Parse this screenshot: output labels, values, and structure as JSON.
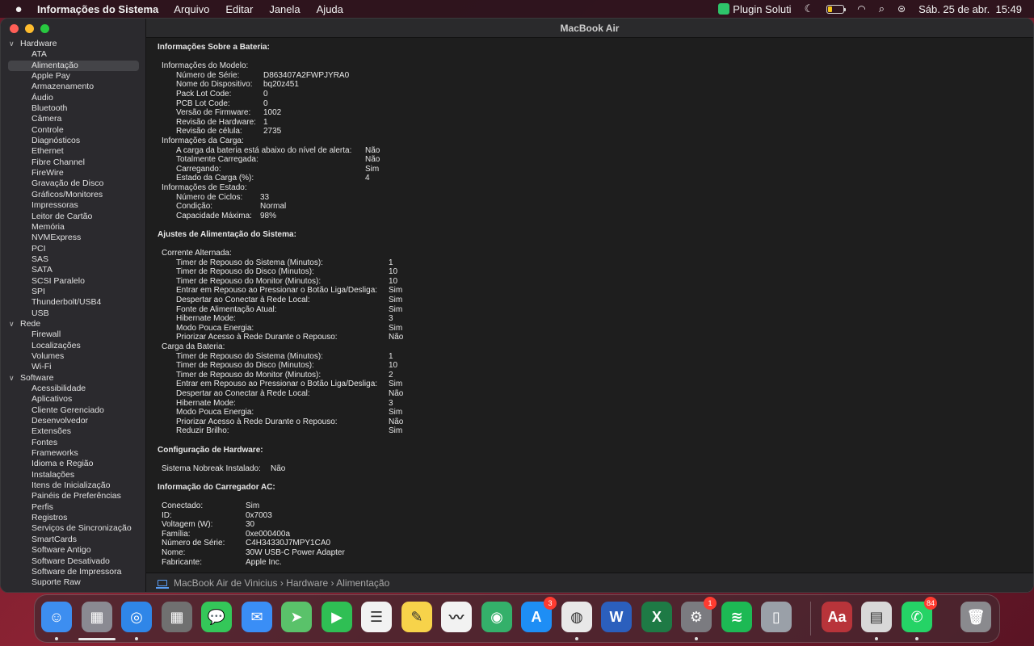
{
  "menubar": {
    "app_name": "Informações do Sistema",
    "menus": [
      "Arquivo",
      "Editar",
      "Janela",
      "Ajuda"
    ],
    "plugin_label": "Plugin Soluti",
    "datetime": "Sáb. 25 de abr.  15:49",
    "battery_level": 0.25
  },
  "window": {
    "title": "MacBook Air"
  },
  "sidebar": {
    "hardware": {
      "label": "Hardware",
      "items": [
        "ATA",
        "Alimentação",
        "Apple Pay",
        "Armazenamento",
        "Áudio",
        "Bluetooth",
        "Câmera",
        "Controle",
        "Diagnósticos",
        "Ethernet",
        "Fibre Channel",
        "FireWire",
        "Gravação de Disco",
        "Gráficos/Monitores",
        "Impressoras",
        "Leitor de Cartão",
        "Memória",
        "NVMExpress",
        "PCI",
        "SAS",
        "SATA",
        "SCSI Paralelo",
        "SPI",
        "Thunderbolt/USB4",
        "USB"
      ]
    },
    "rede": {
      "label": "Rede",
      "items": [
        "Firewall",
        "Localizações",
        "Volumes",
        "Wi-Fi"
      ]
    },
    "software": {
      "label": "Software",
      "items": [
        "Acessibilidade",
        "Aplicativos",
        "Cliente Gerenciado",
        "Desenvolvedor",
        "Extensões",
        "Fontes",
        "Frameworks",
        "Idioma e Região",
        "Instalações",
        "Itens de Inicialização",
        "Painéis de Preferências",
        "Perfis",
        "Registros",
        "Serviços de Sincronização",
        "SmartCards",
        "Software Antigo",
        "Software Desativado",
        "Software de Impressora",
        "Suporte Raw"
      ]
    },
    "selected": "Alimentação"
  },
  "content": {
    "battery_title": "Informações Sobre a Bateria:",
    "model_info": {
      "label": "Informações do Modelo:",
      "rows": [
        [
          "Número de Série:",
          "D863407A2FWPJYRA0"
        ],
        [
          "Nome do Dispositivo:",
          "bq20z451"
        ],
        [
          "Pack Lot Code:",
          "0"
        ],
        [
          "PCB Lot Code:",
          "0"
        ],
        [
          "Versão de Firmware:",
          "1002"
        ],
        [
          "Revisão de Hardware:",
          "1"
        ],
        [
          "Revisão de célula:",
          "2735"
        ]
      ]
    },
    "charge_info": {
      "label": "Informações da Carga:",
      "rows": [
        [
          "A carga da bateria está abaixo do nível de alerta:",
          "Não"
        ],
        [
          "Totalmente Carregada:",
          "Não"
        ],
        [
          "Carregando:",
          "Sim"
        ],
        [
          "Estado da Carga (%):",
          "4"
        ]
      ]
    },
    "health_info": {
      "label": "Informações de Estado:",
      "rows": [
        [
          "Número de Ciclos:",
          "33"
        ],
        [
          "Condição:",
          "Normal"
        ],
        [
          "Capacidade Máxima:",
          "98%"
        ]
      ]
    },
    "power_title": "Ajustes de Alimentação do Sistema:",
    "ac": {
      "label": "Corrente Alternada:",
      "rows": [
        [
          "Timer de Repouso do Sistema (Minutos):",
          "1"
        ],
        [
          "Timer de Repouso do Disco (Minutos):",
          "10"
        ],
        [
          "Timer de Repouso do Monitor (Minutos):",
          "10"
        ],
        [
          "Entrar em Repouso ao Pressionar o Botão Liga/Desliga:",
          "Sim"
        ],
        [
          "Despertar ao Conectar à Rede Local:",
          "Sim"
        ],
        [
          "Fonte de Alimentação Atual:",
          "Sim"
        ],
        [
          "Hibernate Mode:",
          "3"
        ],
        [
          "Modo Pouca Energia:",
          "Sim"
        ],
        [
          "Priorizar Acesso à Rede Durante o Repouso:",
          "Não"
        ]
      ]
    },
    "battery_power": {
      "label": "Carga da Bateria:",
      "rows": [
        [
          "Timer de Repouso do Sistema (Minutos):",
          "1"
        ],
        [
          "Timer de Repouso do Disco (Minutos):",
          "10"
        ],
        [
          "Timer de Repouso do Monitor (Minutos):",
          "2"
        ],
        [
          "Entrar em Repouso ao Pressionar o Botão Liga/Desliga:",
          "Sim"
        ],
        [
          "Despertar ao Conectar à Rede Local:",
          "Não"
        ],
        [
          "Hibernate Mode:",
          "3"
        ],
        [
          "Modo Pouca Energia:",
          "Sim"
        ],
        [
          "Priorizar Acesso à Rede Durante o Repouso:",
          "Não"
        ],
        [
          "Reduzir Brilho:",
          "Sim"
        ]
      ]
    },
    "hw_config_title": "Configuração de Hardware:",
    "hw_config_rows": [
      [
        "Sistema Nobreak Instalado:",
        "Não"
      ]
    ],
    "ac_charger_title": "Informação do Carregador AC:",
    "ac_charger_rows": [
      [
        "Conectado:",
        "Sim"
      ],
      [
        "ID:",
        "0x7003"
      ],
      [
        "Voltagem (W):",
        "30"
      ],
      [
        "Família:",
        "0xe000400a"
      ],
      [
        "Número de Série:",
        "C4H34330J7MPY1CA0"
      ],
      [
        "Nome:",
        "30W USB-C Power Adapter"
      ],
      [
        "Fabricante:",
        "Apple Inc."
      ]
    ]
  },
  "statusbar": {
    "path": [
      "MacBook Air de Vinicius",
      "Hardware",
      "Alimentação"
    ],
    "separator": "›"
  },
  "dock": {
    "apps": [
      {
        "name": "finder",
        "glyph": "☺",
        "color": "#3d8ef0",
        "badge": null,
        "running": true
      },
      {
        "name": "launchpad",
        "glyph": "▦",
        "color": "#8a8a92",
        "badge": null,
        "running": false
      },
      {
        "name": "safari",
        "glyph": "◎",
        "color": "#2f86e8",
        "badge": null,
        "running": true
      },
      {
        "name": "calculator",
        "glyph": "▦",
        "color": "#707070",
        "badge": null,
        "running": false
      },
      {
        "name": "messages",
        "glyph": "💬",
        "color": "#34c759",
        "badge": null,
        "running": false
      },
      {
        "name": "mail",
        "glyph": "✉",
        "color": "#3a8ef6",
        "badge": null,
        "running": false
      },
      {
        "name": "maps",
        "glyph": "➤",
        "color": "#5ac26a",
        "badge": null,
        "running": false
      },
      {
        "name": "facetime",
        "glyph": "▶",
        "color": "#2fbf54",
        "badge": null,
        "running": false
      },
      {
        "name": "reminders",
        "glyph": "☰",
        "color": "#f2f2f2",
        "badge": null,
        "running": false
      },
      {
        "name": "notes",
        "glyph": "✎",
        "color": "#f7d34a",
        "badge": null,
        "running": false
      },
      {
        "name": "freeform",
        "glyph": "〰",
        "color": "#f2f2f2",
        "badge": null,
        "running": false
      },
      {
        "name": "find-my",
        "glyph": "◉",
        "color": "#34b06a",
        "badge": null,
        "running": false
      },
      {
        "name": "app-store",
        "glyph": "A",
        "color": "#1e8ef5",
        "badge": "3",
        "running": false
      },
      {
        "name": "chrome",
        "glyph": "◍",
        "color": "#e8e8e8",
        "badge": null,
        "running": true
      },
      {
        "name": "word",
        "glyph": "W",
        "color": "#2b5fbd",
        "badge": null,
        "running": false
      },
      {
        "name": "excel",
        "glyph": "X",
        "color": "#1e7a45",
        "badge": null,
        "running": false
      },
      {
        "name": "system-settings",
        "glyph": "⚙",
        "color": "#7b7b80",
        "badge": "1",
        "running": true
      },
      {
        "name": "spotify",
        "glyph": "≋",
        "color": "#1db954",
        "badge": null,
        "running": false
      },
      {
        "name": "iphone-mirroring",
        "glyph": "▯",
        "color": "#9aa0a8",
        "badge": null,
        "running": false
      },
      {
        "name": "dictionary",
        "glyph": "Aa",
        "color": "#b8343a",
        "badge": null,
        "running": false
      },
      {
        "name": "system-information",
        "glyph": "▤",
        "color": "#d8d8d8",
        "badge": null,
        "running": true
      },
      {
        "name": "whatsapp",
        "glyph": "✆",
        "color": "#25d366",
        "badge": "84",
        "running": true
      },
      {
        "name": "trash",
        "glyph": "🗑",
        "color": "#8a8a8e",
        "badge": null,
        "running": false
      }
    ]
  }
}
